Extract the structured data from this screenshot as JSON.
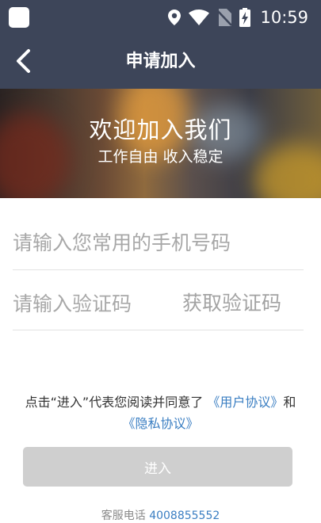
{
  "status_bar": {
    "time": "10:59",
    "icons": [
      "app-icon",
      "location-icon",
      "wifi-icon",
      "no-sim-icon",
      "battery-charging-icon"
    ]
  },
  "nav": {
    "title": "申请加入",
    "back_icon": "chevron-left-icon"
  },
  "banner": {
    "title": "欢迎加入我们",
    "subtitle": "工作自由  收入稳定"
  },
  "form": {
    "phone_placeholder": "请输入您常用的手机号码",
    "code_placeholder": "请输入验证码",
    "get_code_label": "获取验证码"
  },
  "agreement": {
    "prefix": "点击“进入”代表您阅读并同意了 ",
    "user_agreement": "《用户协议》",
    "and": "和 ",
    "privacy_agreement": "《隐私协议》"
  },
  "submit": {
    "label": "进入"
  },
  "service": {
    "label": "客服电话",
    "phone": "4008855552"
  },
  "colors": {
    "header_bg": "#3d4559",
    "link": "#3a7ec2",
    "button_disabled": "#cfcfcf"
  }
}
